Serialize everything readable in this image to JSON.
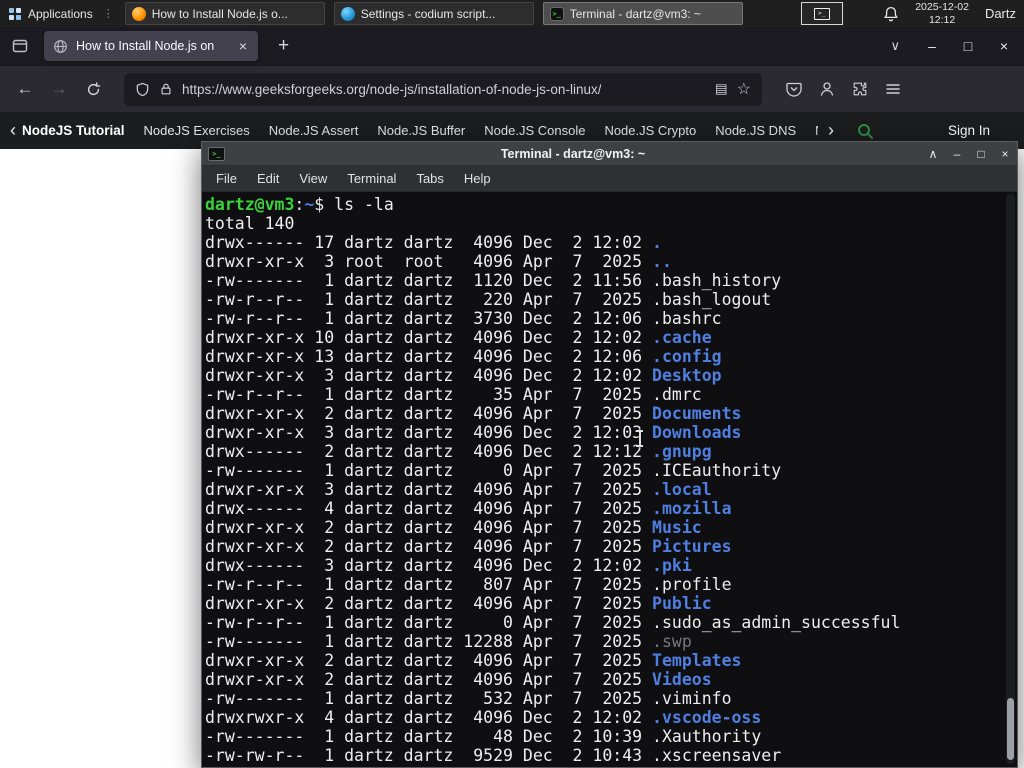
{
  "colors": {
    "panel_bg": "#1f1f1f",
    "tab_bar_bg": "#1c1b22",
    "active_tab_bg": "#42414d",
    "toolbar_bg": "#2b2a33",
    "site_nav_bg": "#1b1d1f",
    "gfg_green": "#2f8d46",
    "terminal_bg": "#0f0f11",
    "terminal_fg": "#eeeeee",
    "prompt_green": "#3bd13b",
    "dir_blue": "#4f7fe0",
    "dim_gray": "#777777"
  },
  "icons": {
    "terminal_glyph": ">_",
    "handle_glyph": "⋮"
  },
  "panel": {
    "applications_label": "Applications",
    "tasks": [
      {
        "label": "How to Install Node.js o...",
        "icon": "firefox"
      },
      {
        "label": "Settings - codium script...",
        "icon": "codium"
      },
      {
        "label": "Terminal - dartz@vm3: ~",
        "icon": "terminal",
        "active": true
      }
    ],
    "clock_date": "2025-12-02",
    "clock_time": "12:12",
    "user": "Dartz"
  },
  "browser": {
    "tab_title": "How to Install Node.js on",
    "tab_close_glyph": "×",
    "new_tab_glyph": "+",
    "tab_list_glyph": "∨",
    "back_glyph": "←",
    "forward_glyph": "→",
    "url": "https://www.geeksforgeeks.org/node-js/installation-of-node-js-on-linux/",
    "reader_glyph": "▤",
    "star_glyph": "☆",
    "minimize_glyph": "–",
    "maximize_glyph": "□",
    "close_glyph": "×"
  },
  "gfg_nav": {
    "scroll_left_glyph": "‹",
    "scroll_right_glyph": "›",
    "items": [
      "NodeJS Tutorial",
      "NodeJS Exercises",
      "Node.JS Assert",
      "Node.JS Buffer",
      "Node.JS Console",
      "Node.JS Crypto",
      "Node.JS DNS",
      "Node"
    ],
    "sign_in": "Sign In"
  },
  "terminal": {
    "title": "Terminal - dartz@vm3: ~",
    "rollup_glyph": "∧",
    "minimize_glyph": "–",
    "maximize_glyph": "□",
    "close_glyph": "×",
    "menus": [
      "File",
      "Edit",
      "View",
      "Terminal",
      "Tabs",
      "Help"
    ],
    "prompt_user_host": "dartz@vm3",
    "prompt_colon": ":",
    "prompt_path": "~",
    "prompt_dollar": "$ ",
    "prompt_command": "ls -la",
    "lines": [
      {
        "text": "total 140"
      },
      {
        "pre": "drwx------ 17 dartz dartz  4096 Dec  2 12:02 ",
        "name": ".",
        "type": "dir"
      },
      {
        "pre": "drwxr-xr-x  3 root  root   4096 Apr  7  2025 ",
        "name": "..",
        "type": "dir"
      },
      {
        "pre": "-rw-------  1 dartz dartz  1120 Dec  2 11:56 ",
        "name": ".bash_history",
        "type": "file"
      },
      {
        "pre": "-rw-r--r--  1 dartz dartz   220 Apr  7  2025 ",
        "name": ".bash_logout",
        "type": "file"
      },
      {
        "pre": "-rw-r--r--  1 dartz dartz  3730 Dec  2 12:06 ",
        "name": ".bashrc",
        "type": "file"
      },
      {
        "pre": "drwxr-xr-x 10 dartz dartz  4096 Dec  2 12:02 ",
        "name": ".cache",
        "type": "dir"
      },
      {
        "pre": "drwxr-xr-x 13 dartz dartz  4096 Dec  2 12:06 ",
        "name": ".config",
        "type": "dir"
      },
      {
        "pre": "drwxr-xr-x  3 dartz dartz  4096 Dec  2 12:02 ",
        "name": "Desktop",
        "type": "dir"
      },
      {
        "pre": "-rw-r--r--  1 dartz dartz    35 Apr  7  2025 ",
        "name": ".dmrc",
        "type": "file"
      },
      {
        "pre": "drwxr-xr-x  2 dartz dartz  4096 Apr  7  2025 ",
        "name": "Documents",
        "type": "dir"
      },
      {
        "pre": "drwxr-xr-x  3 dartz dartz  4096 Dec  2 12:03 ",
        "name": "Downloads",
        "type": "dir"
      },
      {
        "pre": "drwx------  2 dartz dartz  4096 Dec  2 12:12 ",
        "name": ".gnupg",
        "type": "dir"
      },
      {
        "pre": "-rw-------  1 dartz dartz     0 Apr  7  2025 ",
        "name": ".ICEauthority",
        "type": "file"
      },
      {
        "pre": "drwxr-xr-x  3 dartz dartz  4096 Apr  7  2025 ",
        "name": ".local",
        "type": "dir"
      },
      {
        "pre": "drwx------  4 dartz dartz  4096 Apr  7  2025 ",
        "name": ".mozilla",
        "type": "dir"
      },
      {
        "pre": "drwxr-xr-x  2 dartz dartz  4096 Apr  7  2025 ",
        "name": "Music",
        "type": "dir"
      },
      {
        "pre": "drwxr-xr-x  2 dartz dartz  4096 Apr  7  2025 ",
        "name": "Pictures",
        "type": "dir"
      },
      {
        "pre": "drwx------  3 dartz dartz  4096 Dec  2 12:02 ",
        "name": ".pki",
        "type": "dir"
      },
      {
        "pre": "-rw-r--r--  1 dartz dartz   807 Apr  7  2025 ",
        "name": ".profile",
        "type": "file"
      },
      {
        "pre": "drwxr-xr-x  2 dartz dartz  4096 Apr  7  2025 ",
        "name": "Public",
        "type": "dir"
      },
      {
        "pre": "-rw-r--r--  1 dartz dartz     0 Apr  7  2025 ",
        "name": ".sudo_as_admin_successful",
        "type": "file"
      },
      {
        "pre": "-rw-------  1 dartz dartz 12288 Apr  7  2025 ",
        "name": ".swp",
        "type": "dim"
      },
      {
        "pre": "drwxr-xr-x  2 dartz dartz  4096 Apr  7  2025 ",
        "name": "Templates",
        "type": "dir"
      },
      {
        "pre": "drwxr-xr-x  2 dartz dartz  4096 Apr  7  2025 ",
        "name": "Videos",
        "type": "dir"
      },
      {
        "pre": "-rw-------  1 dartz dartz   532 Apr  7  2025 ",
        "name": ".viminfo",
        "type": "file"
      },
      {
        "pre": "drwxrwxr-x  4 dartz dartz  4096 Dec  2 12:02 ",
        "name": ".vscode-oss",
        "type": "dir"
      },
      {
        "pre": "-rw-------  1 dartz dartz    48 Dec  2 10:39 ",
        "name": ".Xauthority",
        "type": "file"
      },
      {
        "pre": "-rw-rw-r--  1 dartz dartz  9529 Dec  2 10:43 ",
        "name": ".xscreensaver",
        "type": "file"
      }
    ]
  }
}
